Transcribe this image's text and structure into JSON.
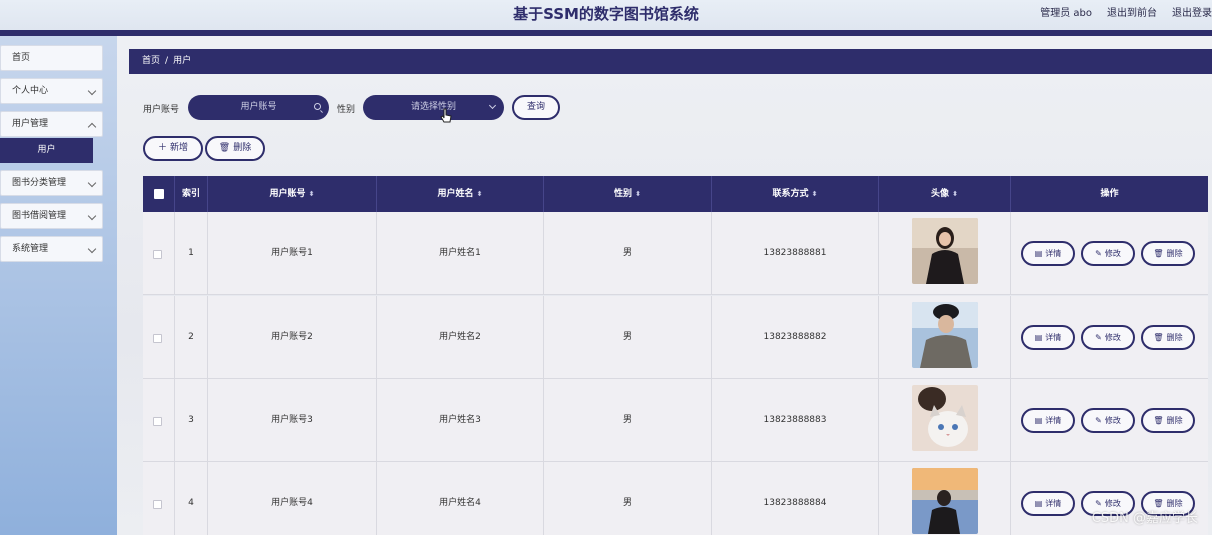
{
  "header": {
    "title": "基于SSM的数字图书馆系统",
    "admin": "管理员 abo",
    "back_front": "退出到前台",
    "logout": "退出登录"
  },
  "sidebar": {
    "items": [
      {
        "label": "首页"
      },
      {
        "label": "个人中心"
      },
      {
        "label": "用户管理"
      },
      {
        "label": "用户"
      },
      {
        "label": "图书分类管理"
      },
      {
        "label": "图书借阅管理"
      },
      {
        "label": "系统管理"
      }
    ]
  },
  "breadcrumb": {
    "home": "首页",
    "sep": "/",
    "current": "用户"
  },
  "search": {
    "account_label": "用户账号",
    "account_placeholder": "用户账号",
    "gender_label": "性别",
    "gender_placeholder": "请选择性别",
    "query_label": "查询"
  },
  "toolbar": {
    "add_label": "新增",
    "delete_label": "删除"
  },
  "table": {
    "columns": [
      "索引",
      "用户账号",
      "用户姓名",
      "性别",
      "联系方式",
      "头像",
      "操作"
    ],
    "rows": [
      {
        "index": "1",
        "account": "用户账号1",
        "name": "用户姓名1",
        "gender": "男",
        "phone": "13823888881"
      },
      {
        "index": "2",
        "account": "用户账号2",
        "name": "用户姓名2",
        "gender": "男",
        "phone": "13823888882"
      },
      {
        "index": "3",
        "account": "用户账号3",
        "name": "用户姓名3",
        "gender": "男",
        "phone": "13823888883"
      },
      {
        "index": "4",
        "account": "用户账号4",
        "name": "用户姓名4",
        "gender": "男",
        "phone": "13823888884"
      }
    ],
    "actions": {
      "detail": "详情",
      "edit": "修改",
      "delete": "删除"
    }
  },
  "watermark": "CSDN @嘉应学长",
  "colors": {
    "primary": "#2e2d6b",
    "sidebar_top": "#c7d6ec",
    "sidebar_bottom": "#8fb0dc"
  }
}
